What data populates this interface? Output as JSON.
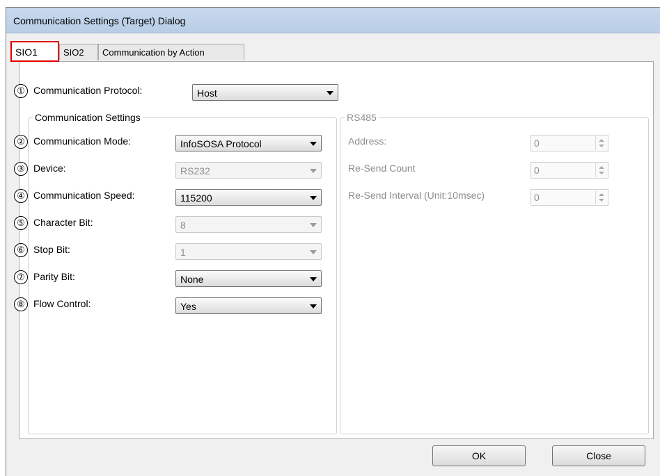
{
  "window": {
    "title": "Communication Settings (Target) Dialog"
  },
  "tabs": [
    {
      "label": "SIO1",
      "active": true
    },
    {
      "label": "SIO2",
      "active": false
    },
    {
      "label": "Communication by Action",
      "active": false
    }
  ],
  "markers": [
    "①",
    "②",
    "③",
    "④",
    "⑤",
    "⑥",
    "⑦",
    "⑧"
  ],
  "protocol": {
    "label": "Communication Protocol:",
    "value": "Host"
  },
  "comm_settings": {
    "title": "Communication Settings",
    "fields": [
      {
        "label": "Communication Mode:",
        "value": "InfoSOSA Protocol",
        "enabled": true
      },
      {
        "label": "Device:",
        "value": "RS232",
        "enabled": false
      },
      {
        "label": "Communication Speed:",
        "value": "115200",
        "enabled": true
      },
      {
        "label": "Character Bit:",
        "value": "8",
        "enabled": false
      },
      {
        "label": "Stop Bit:",
        "value": "1",
        "enabled": false
      },
      {
        "label": "Parity Bit:",
        "value": "None",
        "enabled": true
      },
      {
        "label": "Flow Control:",
        "value": "Yes",
        "enabled": true
      }
    ]
  },
  "rs485": {
    "title": "RS485",
    "fields": [
      {
        "label": "Address:",
        "value": "0"
      },
      {
        "label": "Re-Send Count",
        "value": "0"
      },
      {
        "label": "Re-Send Interval (Unit:10msec)",
        "value": "0"
      }
    ]
  },
  "buttons": {
    "ok": "OK",
    "close": "Close"
  }
}
